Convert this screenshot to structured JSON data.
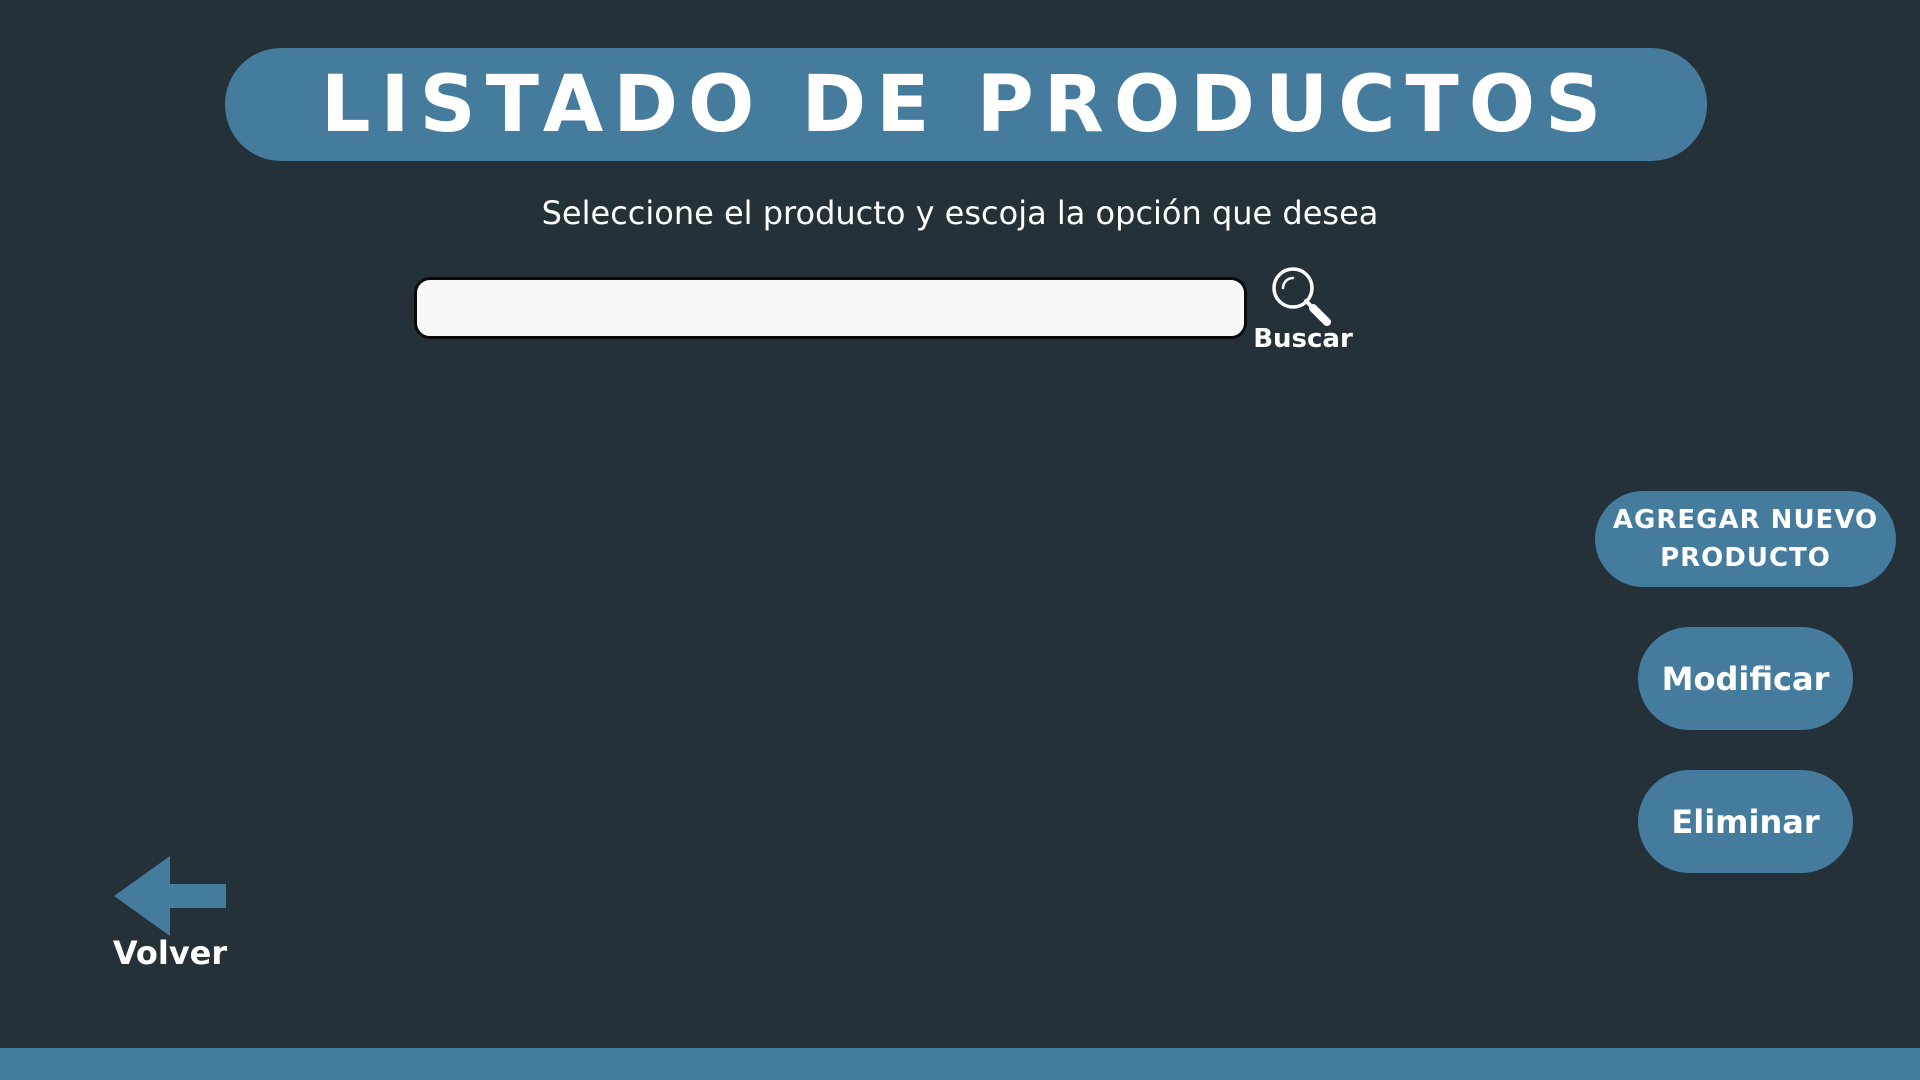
{
  "header": {
    "title": "LISTADO DE PRODUCTOS",
    "subtitle": "Seleccione el producto y escoja la opción que desea"
  },
  "search": {
    "value": "",
    "placeholder": "",
    "button_label": "Buscar",
    "icon": "search-icon"
  },
  "actions": {
    "add_line1": "AGREGAR  NUEVO",
    "add_line2": "PRODUCTO",
    "modify_label": "Modificar",
    "delete_label": "Eliminar"
  },
  "navigation": {
    "back_label": "Volver",
    "back_icon": "arrow-left-icon"
  },
  "colors": {
    "background": "#253139",
    "accent": "#457b9d",
    "text": "#ffffff"
  }
}
